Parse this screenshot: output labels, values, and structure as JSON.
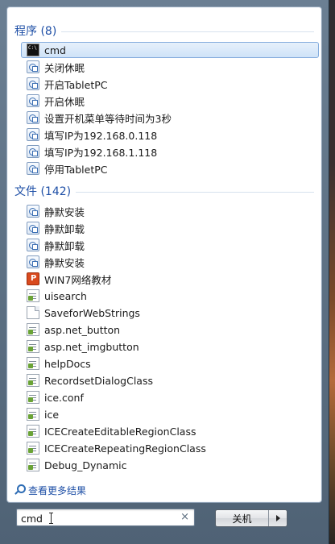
{
  "programs": {
    "header": "程序 (8)",
    "items": [
      {
        "label": "cmd",
        "icon": "cmd-icon"
      },
      {
        "label": "关闭休眠",
        "icon": "shortcut-icon"
      },
      {
        "label": "开启TabletPC",
        "icon": "shortcut-icon"
      },
      {
        "label": "开启休眠",
        "icon": "shortcut-icon"
      },
      {
        "label": "设置开机菜单等待时间为3秒",
        "icon": "shortcut-icon"
      },
      {
        "label": "填写IP为192.168.0.118",
        "icon": "shortcut-icon"
      },
      {
        "label": "填写IP为192.168.1.118",
        "icon": "shortcut-icon"
      },
      {
        "label": "停用TabletPC",
        "icon": "shortcut-icon"
      }
    ]
  },
  "files": {
    "header": "文件 (142)",
    "items": [
      {
        "label": "静默安装",
        "icon": "shortcut-icon"
      },
      {
        "label": "静默卸载",
        "icon": "shortcut-icon"
      },
      {
        "label": "静默卸载",
        "icon": "shortcut-icon"
      },
      {
        "label": "静默安装",
        "icon": "shortcut-icon"
      },
      {
        "label": "WIN7网络教材",
        "icon": "powerpoint-icon"
      },
      {
        "label": "uisearch",
        "icon": "script-icon"
      },
      {
        "label": "SaveforWebStrings",
        "icon": "document-icon"
      },
      {
        "label": "asp.net_button",
        "icon": "script-icon"
      },
      {
        "label": "asp.net_imgbutton",
        "icon": "script-icon"
      },
      {
        "label": "helpDocs",
        "icon": "script-icon"
      },
      {
        "label": "RecordsetDialogClass",
        "icon": "script-icon"
      },
      {
        "label": "ice.conf",
        "icon": "script-icon"
      },
      {
        "label": "ice",
        "icon": "script-icon"
      },
      {
        "label": "ICECreateEditableRegionClass",
        "icon": "script-icon"
      },
      {
        "label": "ICECreateRepeatingRegionClass",
        "icon": "script-icon"
      },
      {
        "label": "Debug_Dynamic",
        "icon": "script-icon"
      }
    ]
  },
  "see_more": "查看更多结果",
  "search": {
    "value": "cmd",
    "clear": "×"
  },
  "shutdown": {
    "label": "关机"
  },
  "colors": {
    "accent": "#1e4fa6",
    "selection": "#cfe3f8"
  }
}
